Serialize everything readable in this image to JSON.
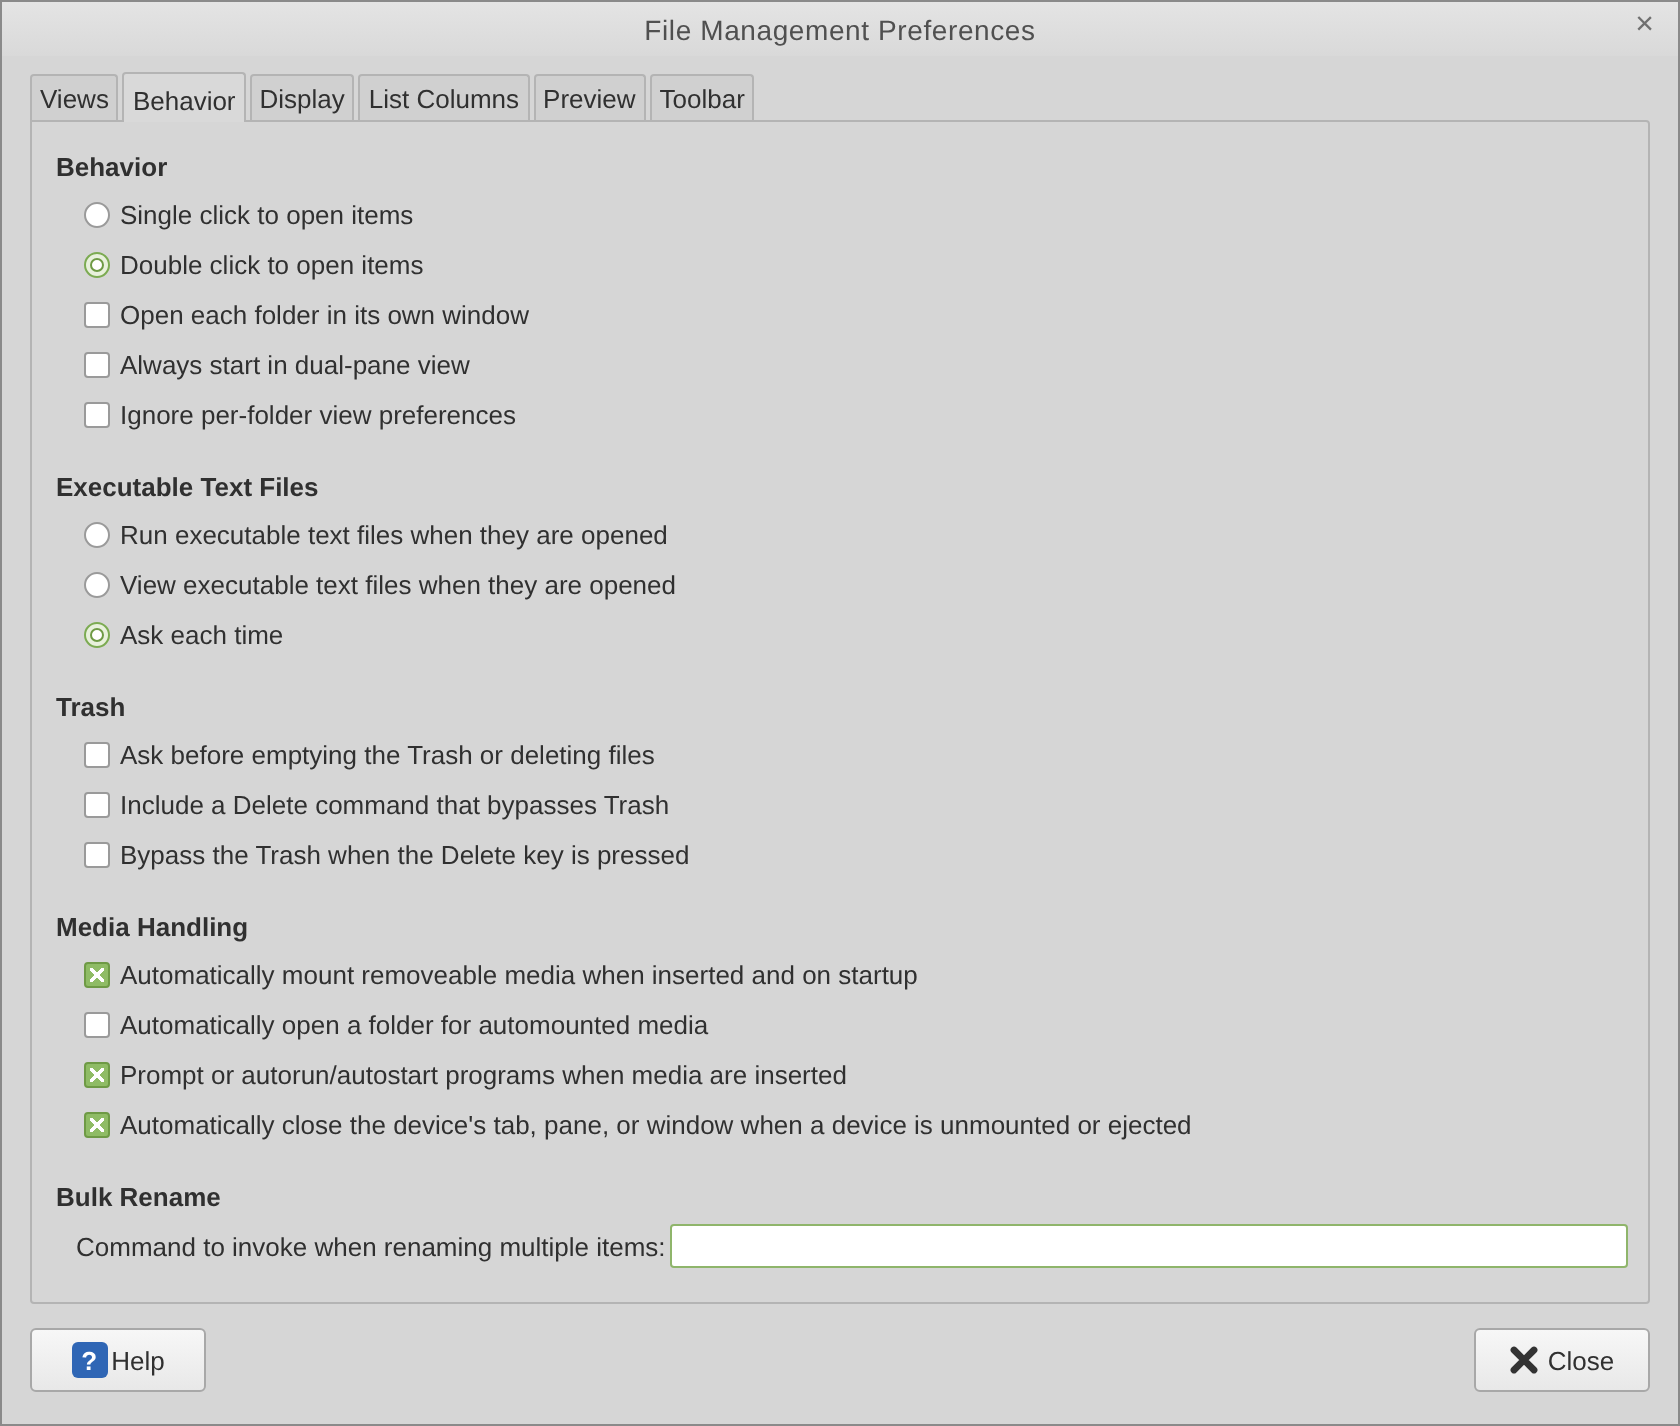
{
  "window": {
    "title": "File Management Preferences",
    "close": "×"
  },
  "tabs": [
    {
      "label": "Views",
      "selected": false
    },
    {
      "label": "Behavior",
      "selected": true
    },
    {
      "label": "Display",
      "selected": false
    },
    {
      "label": "List Columns",
      "selected": false
    },
    {
      "label": "Preview",
      "selected": false
    },
    {
      "label": "Toolbar",
      "selected": false
    }
  ],
  "sections": [
    {
      "title": "Behavior",
      "items": [
        {
          "kind": "radio",
          "label": "Single click to open items",
          "selected": false
        },
        {
          "kind": "radio",
          "label": "Double click to open items",
          "selected": true
        },
        {
          "kind": "checkbox",
          "label": "Open each folder in its own window",
          "checked": false
        },
        {
          "kind": "checkbox",
          "label": "Always start in dual-pane view",
          "checked": false
        },
        {
          "kind": "checkbox",
          "label": "Ignore per-folder view preferences",
          "checked": false
        }
      ]
    },
    {
      "title": "Executable Text Files",
      "items": [
        {
          "kind": "radio",
          "label": "Run executable text files when they are opened",
          "selected": false
        },
        {
          "kind": "radio",
          "label": "View executable text files when they are opened",
          "selected": false
        },
        {
          "kind": "radio",
          "label": "Ask each time",
          "selected": true
        }
      ]
    },
    {
      "title": "Trash",
      "items": [
        {
          "kind": "checkbox",
          "label": "Ask before emptying the Trash or deleting files",
          "checked": false
        },
        {
          "kind": "checkbox",
          "label": "Include a Delete command that bypasses Trash",
          "checked": false
        },
        {
          "kind": "checkbox",
          "label": "Bypass the Trash when the Delete key is pressed",
          "checked": false
        }
      ]
    },
    {
      "title": "Media Handling",
      "items": [
        {
          "kind": "checkbox",
          "label": "Automatically mount removeable media when inserted and on startup",
          "checked": true
        },
        {
          "kind": "checkbox",
          "label": "Automatically open a folder for automounted media",
          "checked": false
        },
        {
          "kind": "checkbox",
          "label": "Prompt or autorun/autostart programs when media are inserted",
          "checked": true
        },
        {
          "kind": "checkbox",
          "label": "Automatically close the device's tab, pane, or window when a device is unmounted or ejected",
          "checked": true
        }
      ]
    },
    {
      "title": "Bulk Rename",
      "items": [
        {
          "kind": "field",
          "label": "Command to invoke when renaming multiple items:",
          "value": ""
        }
      ]
    }
  ],
  "buttons": [
    {
      "kind": "help",
      "label": "Help",
      "icon": "?"
    },
    {
      "kind": "close",
      "label": "Close"
    }
  ]
}
